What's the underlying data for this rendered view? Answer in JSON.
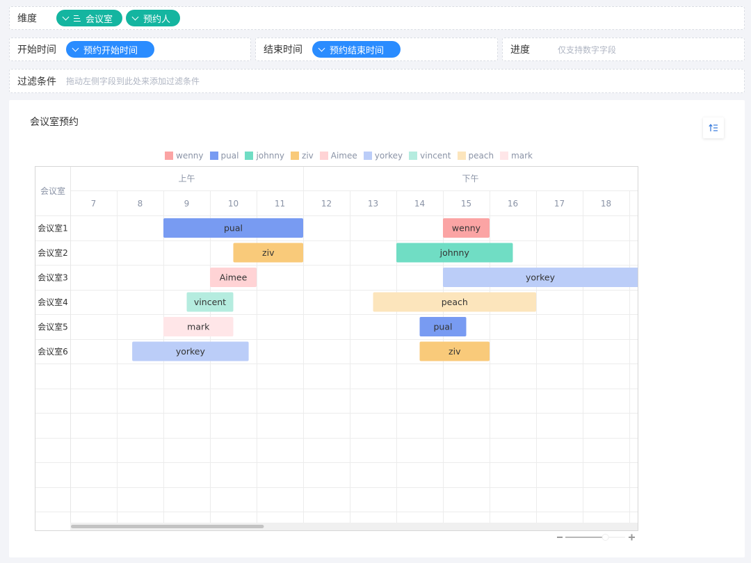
{
  "config": {
    "dimension": {
      "label": "维度",
      "fields": [
        {
          "label": "会议室",
          "sorted": true,
          "color": "#14b5a0"
        },
        {
          "label": "预约人",
          "sorted": false,
          "color": "#14b5a0"
        }
      ]
    },
    "start_time": {
      "label": "开始时间",
      "field": "预约开始时间",
      "color": "#2a8cff"
    },
    "end_time": {
      "label": "结束时间",
      "field": "预约结束时间",
      "color": "#2a8cff"
    },
    "progress": {
      "label": "进度",
      "placeholder": "仅支持数字字段"
    },
    "filter": {
      "label": "过滤条件",
      "placeholder": "拖动左侧字段到此处来添加过滤条件"
    }
  },
  "chart_data": {
    "type": "gantt",
    "title": "会议室预约",
    "row_header": "会议室",
    "period_labels": [
      {
        "label": "上午",
        "from": 7,
        "to": 12
      },
      {
        "label": "下午",
        "from": 12,
        "to": 19.2
      }
    ],
    "x_ticks": [
      7,
      8,
      9,
      10,
      11,
      12,
      13,
      14,
      15,
      16,
      17,
      18
    ],
    "x_range": [
      7,
      19.15
    ],
    "rows": [
      "会议室1",
      "会议室2",
      "会议室3",
      "会议室4",
      "会议室5",
      "会议室6"
    ],
    "empty_rows": 7,
    "legend_position": "top",
    "legend": [
      {
        "name": "wenny",
        "color": "#fba4a4"
      },
      {
        "name": "pual",
        "color": "#789bf2"
      },
      {
        "name": "johnny",
        "color": "#70ddc4"
      },
      {
        "name": "ziv",
        "color": "#f9ca7a"
      },
      {
        "name": "Aimee",
        "color": "#ffd3d5"
      },
      {
        "name": "yorkey",
        "color": "#bbcdf8"
      },
      {
        "name": "vincent",
        "color": "#b5ecdf"
      },
      {
        "name": "peach",
        "color": "#fce5bc"
      },
      {
        "name": "mark",
        "color": "#ffe6e8"
      }
    ],
    "tasks": [
      {
        "row": "会议室1",
        "person": "pual",
        "start": 9,
        "end": 12
      },
      {
        "row": "会议室1",
        "person": "wenny",
        "start": 15,
        "end": 16
      },
      {
        "row": "会议室2",
        "person": "ziv",
        "start": 10.5,
        "end": 12
      },
      {
        "row": "会议室2",
        "person": "johnny",
        "start": 14,
        "end": 16.5
      },
      {
        "row": "会议室3",
        "person": "Aimee",
        "start": 10,
        "end": 11
      },
      {
        "row": "会议室3",
        "person": "yorkey",
        "start": 15,
        "end": 19.5
      },
      {
        "row": "会议室4",
        "person": "vincent",
        "start": 9.5,
        "end": 10.5
      },
      {
        "row": "会议室4",
        "person": "peach",
        "start": 13.5,
        "end": 17
      },
      {
        "row": "会议室5",
        "person": "mark",
        "start": 9,
        "end": 10.5
      },
      {
        "row": "会议室5",
        "person": "pual",
        "start": 14.5,
        "end": 15.5
      },
      {
        "row": "会议室6",
        "person": "yorkey",
        "start": 8.33,
        "end": 10.83
      },
      {
        "row": "会议室6",
        "person": "ziv",
        "start": 14.5,
        "end": 16
      }
    ],
    "scroll_fraction": 0.34,
    "zoom_level": 0.67
  }
}
